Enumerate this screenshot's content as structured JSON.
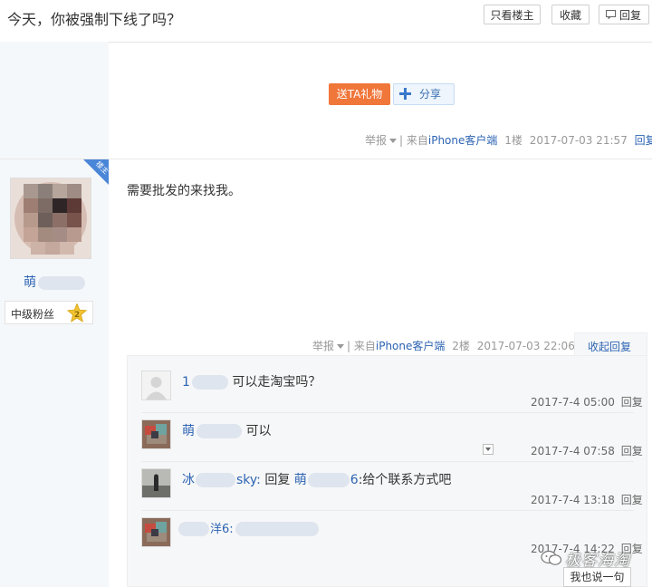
{
  "header": {
    "title": "今天，你被强制下线了吗？",
    "only_op_label": "只看楼主",
    "favorite_label": "收藏",
    "reply_label": "回复"
  },
  "floor1": {
    "gift_label": "送TA礼物",
    "share_label": "分享",
    "report_label": "举报",
    "source_prefix": "| 来自",
    "source_client": "iPhone客户端",
    "floor": "1楼",
    "time": "2017-07-03 21:57",
    "reply_link": "回复"
  },
  "author": {
    "badge_text": "楼主",
    "name_visible": "萌",
    "rank_label": "中级粉丝",
    "level": "2"
  },
  "floor2": {
    "content": "需要批发的来找我。",
    "report_label": "举报",
    "source_prefix": "| 来自",
    "source_client": "iPhone客户端",
    "floor": "2楼",
    "time": "2017-07-03 22:06",
    "collapse_label": "收起回复"
  },
  "replies": [
    {
      "name_visible": "1",
      "text": "可以走淘宝吗？",
      "time": "2017-7-4 05:00",
      "reply_label": "回复"
    },
    {
      "name_visible": "萌",
      "text": "可以",
      "time": "2017-7-4 07:58",
      "reply_label": "回复"
    },
    {
      "name_visible": "冰",
      "name_tail": "sky:",
      "text_prefix": "回复",
      "target_visible": "萌",
      "target_tail": "6",
      "text": ":给个联系方式吧",
      "time": "2017-7-4 13:18",
      "reply_label": "回复"
    },
    {
      "name_visible": "洋6:",
      "text": "",
      "time": "2017-7-4 14:22",
      "reply_label": "回复"
    }
  ],
  "say_label": "我也说一句",
  "watermark": "极客海淘",
  "colors": {
    "link": "#2d64b3",
    "gift_button": "#f0763a",
    "badge": "#4a86d8",
    "level_badge": "#f3c433"
  }
}
